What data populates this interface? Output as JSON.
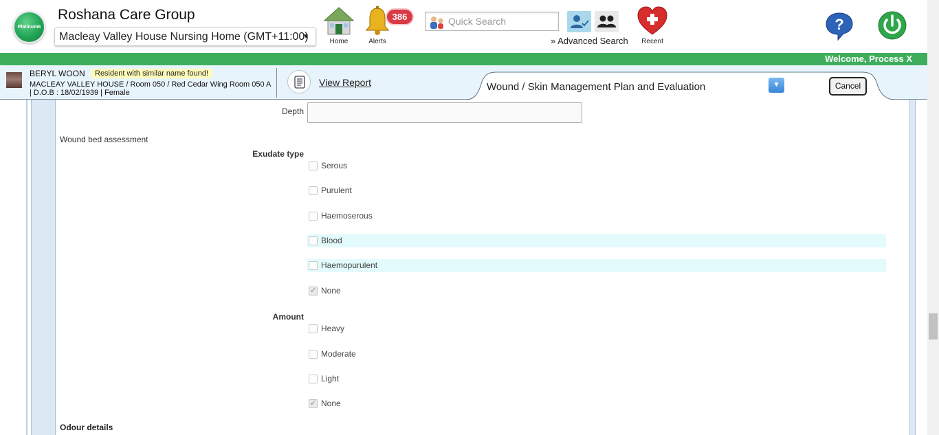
{
  "header": {
    "logo_text": "Platinum6",
    "org_name": "Roshana Care Group",
    "facility": "Macleay Valley House Nursing Home (GMT+11:00)",
    "home_label": "Home",
    "alerts_label": "Alerts",
    "alerts_count": "386",
    "search_placeholder": "Quick Search",
    "advanced_search": "Advanced Search",
    "recent_label": "Recent",
    "welcome": "Welcome, Process X"
  },
  "resident": {
    "name": "BERYL WOON",
    "alert": "Resident with similar name found!",
    "location": "MACLEAY VALLEY HOUSE / Room 050 / Red Cedar Wing Room 050 A",
    "dob": "| D.O.B : 18/02/1939 | Female",
    "view_report": "View Report",
    "form_title": "Wound / Skin Management Plan and Evaluation",
    "cancel": "Cancel"
  },
  "form": {
    "depth_label": "Depth",
    "depth_value": "",
    "wound_bed_label": "Wound bed assessment",
    "exudate_type_label": "Exudate type",
    "exudate_types": [
      {
        "label": "Serous",
        "checked": false
      },
      {
        "label": "Purulent",
        "checked": false
      },
      {
        "label": "Haemoserous",
        "checked": false
      },
      {
        "label": "Blood",
        "checked": false
      },
      {
        "label": "Haemopurulent",
        "checked": false
      },
      {
        "label": "None",
        "checked": true
      }
    ],
    "amount_label": "Amount",
    "amounts": [
      {
        "label": "Heavy",
        "checked": false
      },
      {
        "label": "Moderate",
        "checked": false
      },
      {
        "label": "Light",
        "checked": false
      },
      {
        "label": "None",
        "checked": true
      }
    ],
    "odour_label": "Odour details"
  },
  "colors": {
    "green_bar": "#3fae5c",
    "resident_bar": "#e8f4fb",
    "alert_badge": "#d93a45",
    "row_highlight": "#e3fbfc"
  }
}
